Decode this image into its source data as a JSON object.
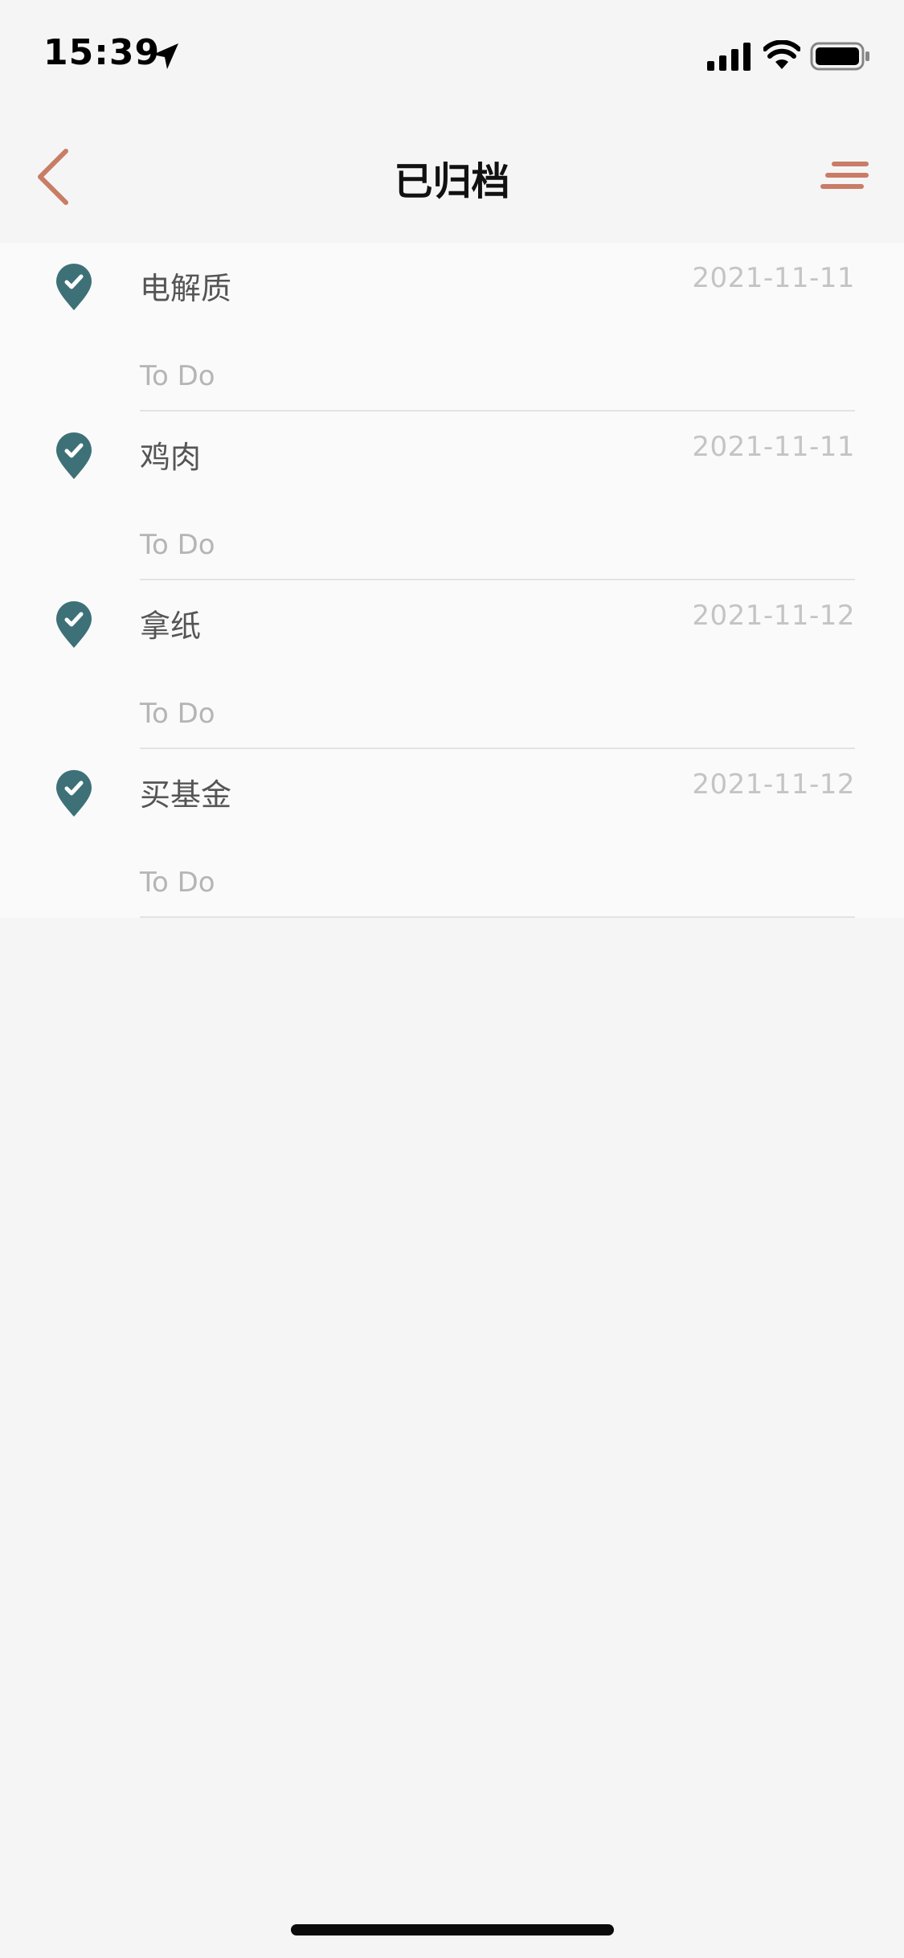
{
  "status_bar": {
    "time": "15:39"
  },
  "nav": {
    "title": "已归档"
  },
  "colors": {
    "accent": "#c97c66",
    "check": "#3d7177"
  },
  "items": [
    {
      "title": "电解质",
      "date": "2021-11-11",
      "subtitle": "To Do"
    },
    {
      "title": "鸡肉",
      "date": "2021-11-11",
      "subtitle": "To Do"
    },
    {
      "title": "拿纸",
      "date": "2021-11-12",
      "subtitle": "To Do"
    },
    {
      "title": "买基金",
      "date": "2021-11-12",
      "subtitle": "To Do"
    }
  ]
}
